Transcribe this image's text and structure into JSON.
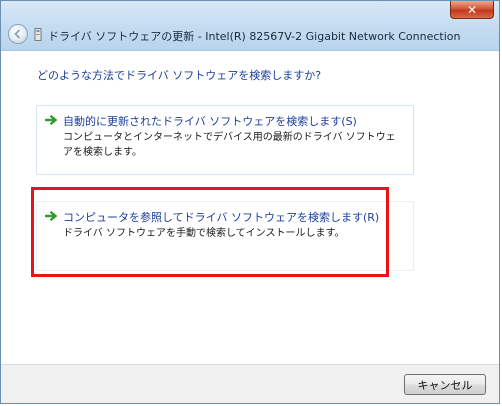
{
  "window": {
    "title": "ドライバ ソフトウェアの更新 - Intel(R) 82567V-2 Gigabit Network Connection",
    "close_glyph": "✕"
  },
  "main": {
    "question": "どのような方法でドライバ ソフトウェアを検索しますか?",
    "options": [
      {
        "title": "自動的に更新されたドライバ ソフトウェアを検索します(S)",
        "description": "コンピュータとインターネットでデバイス用の最新のドライバ ソフトウェアを検索します。",
        "icon": "green-arrow-icon"
      },
      {
        "title": "コンピュータを参照してドライバ ソフトウェアを検索します(R)",
        "description": "ドライバ ソフトウェアを手動で検索してインストールします。",
        "icon": "green-arrow-icon"
      }
    ]
  },
  "footer": {
    "cancel_label": "キャンセル"
  },
  "colors": {
    "link_blue": "#1c3f9a",
    "arrow_green": "#2f9e2f",
    "highlight_red": "#e8141a"
  }
}
